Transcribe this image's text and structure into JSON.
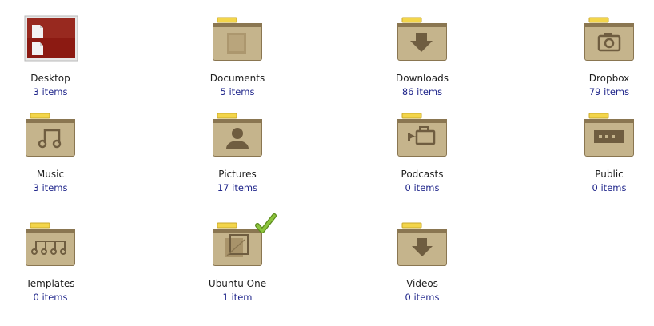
{
  "items": [
    {
      "name": "Desktop",
      "count": "3 items",
      "icon": "desktop-icon"
    },
    {
      "name": "Documents",
      "count": "5 items",
      "icon": "documents-folder-icon"
    },
    {
      "name": "Downloads",
      "count": "86 items",
      "icon": "downloads-folder-icon"
    },
    {
      "name": "Dropbox",
      "count": "79 items",
      "icon": "dropbox-folder-icon"
    },
    {
      "name": "Music",
      "count": "3 items",
      "icon": "music-folder-icon"
    },
    {
      "name": "Pictures",
      "count": "17 items",
      "icon": "pictures-folder-icon"
    },
    {
      "name": "Podcasts",
      "count": "0 items",
      "icon": "podcasts-folder-icon"
    },
    {
      "name": "Public",
      "count": "0 items",
      "icon": "public-folder-icon"
    },
    {
      "name": "Templates",
      "count": "0 items",
      "icon": "templates-folder-icon"
    },
    {
      "name": "Ubuntu One",
      "count": "1 item",
      "icon": "ubuntu-one-folder-icon",
      "emblem": "sync-ok-checkmark-icon"
    },
    {
      "name": "Videos",
      "count": "0 items",
      "icon": "videos-folder-icon"
    }
  ],
  "colors": {
    "folder_body": "#c5b48c",
    "folder_tab": "#8a7651",
    "folder_label": "#f3d54a",
    "glyph": "#6f5d40",
    "desktop_red": "#8c1a12",
    "count_text": "#22288c",
    "check_green": "#8cc43c"
  }
}
